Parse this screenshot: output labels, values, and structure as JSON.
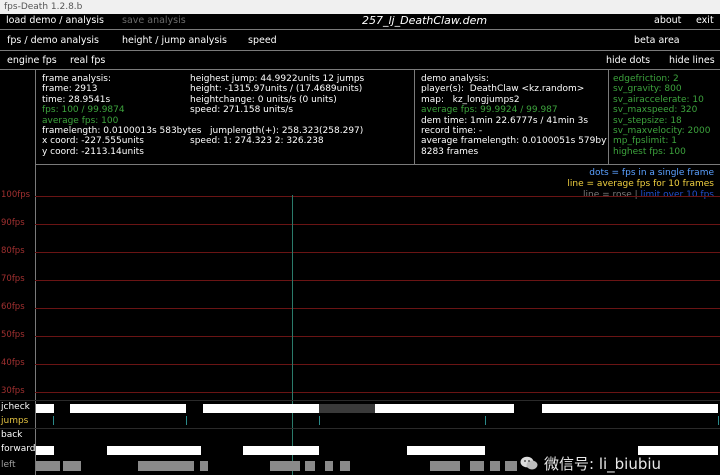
{
  "window": {
    "title": "fps-Death 1.2.8.b"
  },
  "menu": {
    "load": "load demo / analysis",
    "save": "save analysis",
    "demo_file": "257_lj_DeathClaw.dem",
    "about": "about",
    "exit": "exit"
  },
  "tabs": {
    "fps_demo": "fps / demo analysis",
    "height_jump": "height / jump analysis",
    "speed": "speed",
    "beta": "beta area"
  },
  "subnav": {
    "engine_fps": "engine fps",
    "real_fps": "real fps",
    "hide_dots": "hide dots",
    "hide_lines": "hide lines"
  },
  "frame_analysis": {
    "title": "frame analysis:",
    "frame": "frame: 2913",
    "time": "time: 28.9541s",
    "fps": "fps: 100 / 99.9874",
    "average_fps": "average fps: 100",
    "framelength": "framelength: 0.0100013s 583bytes",
    "x_coord": "x coord: -227.555units",
    "y_coord": "y coord: -2113.14units"
  },
  "jump_analysis": {
    "highest_jump": "heighest jump: 44.9922units 12 jumps",
    "height": "height: -1315.97units / (17.4689units)",
    "heightchange": "heightchange: 0 units/s (0 units)",
    "speed": "speed: 271.158 units/s",
    "jumplength": "jumplength(+): 258.323(258.297)",
    "speed12": "speed: 1: 274.323 2: 326.238"
  },
  "demo_analysis": {
    "title": "demo analysis:",
    "players": "player(s):  DeathClaw <kz.random>",
    "map": "map:   kz_longjumps2",
    "average_fps": "average fps: 99.9924 / 99.987",
    "dem_time": "dem time: 1min 22.6777s / 41min 3s",
    "record_time": "record time: -",
    "average_framelength": "average framelength: 0.0100051s 579bytes",
    "frames": "8283 frames"
  },
  "server_vars": {
    "edgefriction": "edgefriction: 2",
    "gravity": "sv_gravity: 800",
    "airaccelerate": "sv_airaccelerate: 10",
    "maxspeed": "sv_maxspeed: 320",
    "stepsize": "sv_stepsize: 18",
    "maxvelocity": "sv_maxvelocity: 2000",
    "fps_max": "mp_fpslimit: 1",
    "highest_fps": "highest fps: 100"
  },
  "legend": {
    "dots": "dots = fps in a single frame",
    "line": "line = average fps for 10 frames",
    "line_rose": "line = rose |",
    "line_rose_extra": "limit over 10 fps"
  },
  "fps_axis": [
    "100fps",
    "90fps",
    "80fps",
    "70fps",
    "60fps",
    "50fps",
    "40fps",
    "30fps"
  ],
  "rows": {
    "jcheck": "jcheck",
    "jumps": "jumps",
    "back": "back",
    "forward": "forward",
    "left": "left"
  },
  "watermark": "微信号: li_biubiu",
  "colors": {
    "green": "#3da33d",
    "fps_label": "#a13030",
    "legend_dots": "#5aa0ff",
    "legend_line": "#f0d040",
    "jumps_label": "#e0c040"
  }
}
